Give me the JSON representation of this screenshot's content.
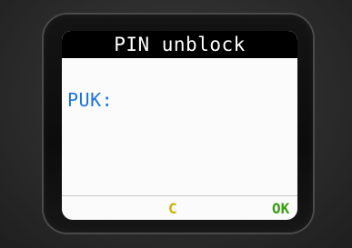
{
  "screen": {
    "title": "PIN unblock",
    "field_label": "PUK:"
  },
  "softkeys": {
    "left_label": "C",
    "right_label": "OK"
  },
  "colors": {
    "label": "#1b73d6",
    "clear_key": "#c9b400",
    "ok_key": "#3aa012"
  }
}
